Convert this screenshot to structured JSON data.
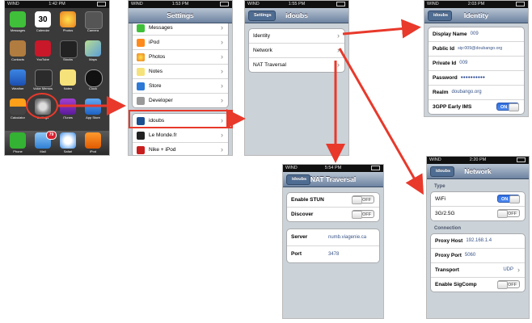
{
  "home": {
    "status": {
      "carrier": "WIND",
      "time": "1:42 PM"
    },
    "apps": [
      "Messages",
      "Calendar",
      "Photos",
      "Camera",
      "Contacts",
      "YouTube",
      "Stocks",
      "Maps",
      "Weather",
      "Voice Memos",
      "Notes",
      "Clock",
      "Calculator",
      "Settings",
      "iTunes",
      "App Store"
    ],
    "calendar_day": "30",
    "dock": [
      "Phone",
      "Mail",
      "Safari",
      "iPod"
    ],
    "mail_badge": "79"
  },
  "settings": {
    "status": {
      "carrier": "WIND",
      "time": "1:53 PM"
    },
    "title": "Settings",
    "items_group1": [
      "Messages",
      "iPod",
      "Photos",
      "Notes",
      "Store",
      "Developer"
    ],
    "items_group2": [
      "idoubs",
      "Le Monde.fr",
      "Nike + iPod"
    ]
  },
  "idoubs": {
    "status": {
      "carrier": "WIND",
      "time": "1:55 PM"
    },
    "back": "Settings",
    "title": "idoubs",
    "items": [
      "Identity",
      "Network",
      "NAT Traversal"
    ]
  },
  "identity": {
    "status": {
      "carrier": "WIND",
      "time": "2:03 PM"
    },
    "back": "idoubs",
    "title": "Identity",
    "rows": [
      {
        "label": "Display Name",
        "value": "009"
      },
      {
        "label": "Public Id",
        "value": "sip:009@doubango.org"
      },
      {
        "label": "Private Id",
        "value": "009"
      },
      {
        "label": "Password",
        "value": "●●●●●●●●●●"
      },
      {
        "label": "Realm",
        "value": "doubango.org"
      }
    ],
    "ims_label": "3GPP Early IMS",
    "ims_state": "ON"
  },
  "nat": {
    "status": {
      "carrier": "WIND",
      "time": "5:54 PM"
    },
    "back": "idoubs",
    "title": "NAT Traversal",
    "stun_label": "Enable STUN",
    "stun_state": "OFF",
    "discover_label": "Discover",
    "discover_state": "OFF",
    "server_label": "Server",
    "server_value": "numb.viagenie.ca",
    "port_label": "Port",
    "port_value": "3478"
  },
  "network": {
    "status": {
      "carrier": "WIND",
      "time": "2:20 PM"
    },
    "back": "idoubs",
    "title": "Network",
    "type_header": "Type",
    "wifi_label": "WiFi",
    "wifi_state": "ON",
    "g_label": "3G/2.5G",
    "g_state": "OFF",
    "conn_header": "Connection",
    "proxy_host_label": "Proxy Host",
    "proxy_host_value": "192.168.1.4",
    "proxy_port_label": "Proxy Port",
    "proxy_port_value": "5060",
    "transport_label": "Transport",
    "transport_value": "UDP",
    "sigcomp_label": "Enable SigComp",
    "sigcomp_state": "OFF"
  },
  "colors": {
    "arrow": "#e8392b",
    "toggle_on": "#2f6de1",
    "nav": "#6d83a1"
  }
}
